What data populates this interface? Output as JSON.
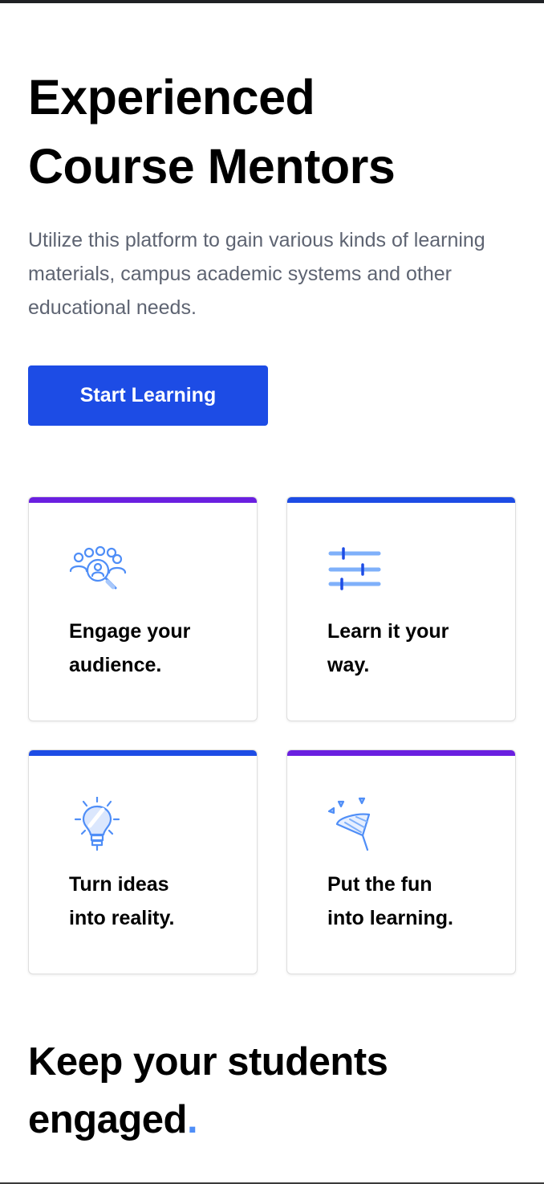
{
  "hero": {
    "title_line1": "Experienced",
    "title_line2": "Course Mentors",
    "description": "Utilize this platform to gain various kinds of learning materials, campus academic systems and other educational needs.",
    "cta_label": "Start Learning"
  },
  "colors": {
    "primary_button": "#1d4ce5",
    "accent_purple": "#6a1fe0",
    "accent_blue": "#1d4ce5",
    "icon_blue": "#4f8ef7",
    "text_muted": "#5e6472"
  },
  "features": [
    {
      "icon": "audience-search-icon",
      "label_line1": "Engage your",
      "label_line2": "audience.",
      "accent": "purple"
    },
    {
      "icon": "sliders-icon",
      "label_line1": "Learn it your",
      "label_line2": "way.",
      "accent": "blue"
    },
    {
      "icon": "lightbulb-icon",
      "label_line1": "Turn ideas",
      "label_line2": "into reality.",
      "accent": "blue"
    },
    {
      "icon": "party-popper-icon",
      "label_line1": "Put the fun",
      "label_line2": "into learning.",
      "accent": "purple"
    }
  ],
  "section": {
    "title_line1": "Keep your students",
    "title_line2": "engaged",
    "title_dot": "."
  }
}
